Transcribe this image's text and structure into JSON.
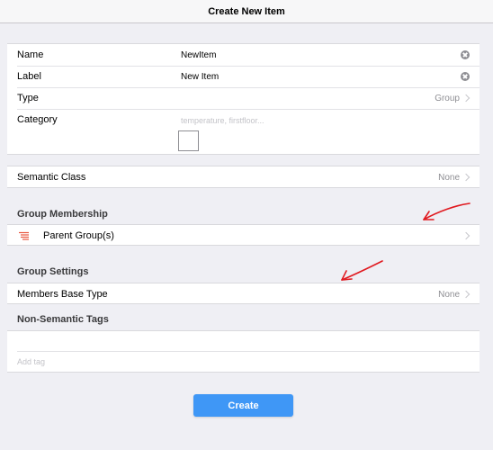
{
  "navbar": {
    "title": "Create New Item"
  },
  "details": {
    "name": {
      "label": "Name",
      "value": "NewItem"
    },
    "label_field": {
      "label": "Label",
      "value": "New Item"
    },
    "type": {
      "label": "Type",
      "value": "Group"
    },
    "category": {
      "label": "Category",
      "placeholder": "temperature, firstfloor..."
    }
  },
  "semantic": {
    "label": "Semantic Class",
    "value": "None"
  },
  "group_membership": {
    "title": "Group Membership",
    "parent_label": "Parent Group(s)"
  },
  "group_settings": {
    "title": "Group Settings",
    "base_type_label": "Members Base Type",
    "base_type_value": "None"
  },
  "tags": {
    "title": "Non-Semantic Tags",
    "add_placeholder": "Add tag"
  },
  "actions": {
    "create_label": "Create"
  },
  "colors": {
    "accent": "#3f97f6",
    "annotation": "#e0191f",
    "group_icon": "#e8573f"
  }
}
